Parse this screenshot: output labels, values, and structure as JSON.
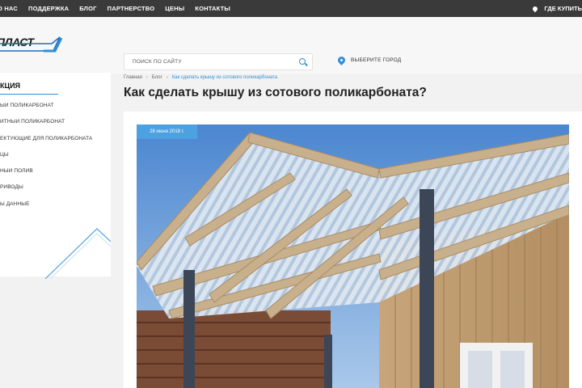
{
  "topnav": {
    "items": [
      "О НАС",
      "ПОДДЕРЖКА",
      "БЛОГ",
      "ПАРТНЕРСТВО",
      "ЦЕНЫ",
      "КОНТАКТЫ"
    ],
    "where_to_buy": "ГДЕ КУПИТЬ"
  },
  "header": {
    "logo_text": "ПЛАСТ",
    "search_placeholder": "ПОИСК ПО САЙТУ",
    "city_label": "ВЫБЕРИТЕ ГОРОД"
  },
  "sidebar": {
    "title": "КЦИЯ",
    "items": [
      "ЫЙ ПОЛИКАРБОНАТ",
      "ИТНЫЙ ПОЛИКАРБОНАТ",
      "ЕКТУЮЩИЕ ДЛЯ ПОЛИКАРБОНАТА",
      "ЦЫ",
      "НЫЙ ПОЛИВ",
      "РИВОДЫ",
      "Ы ДАННЫЕ"
    ]
  },
  "breadcrumb": {
    "home": "Главная",
    "blog": "Блог",
    "current": "Как сделать крышу из сотового поликарбоната"
  },
  "article": {
    "title": "Как сделать крышу из сотового поликарбоната?",
    "date": "28 июня 2018 г."
  },
  "colors": {
    "accent": "#2f8ed6",
    "topbar": "#3a3a3a",
    "date_badge": "#4da1e0"
  }
}
